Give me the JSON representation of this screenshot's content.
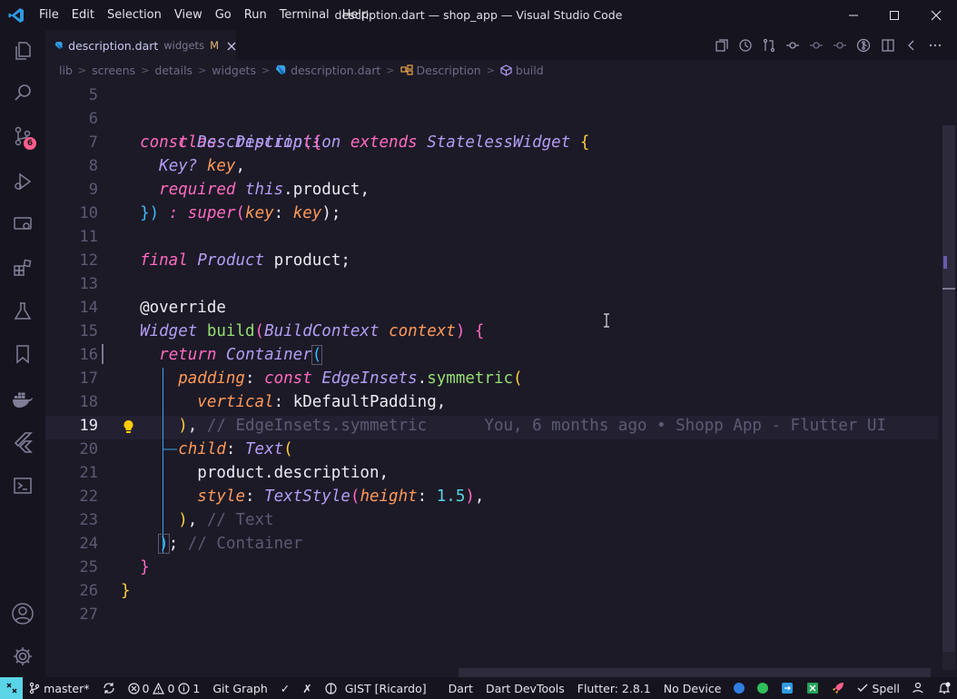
{
  "window": {
    "title": "description.dart — shop_app — Visual Studio Code"
  },
  "menu": [
    "File",
    "Edit",
    "Selection",
    "View",
    "Go",
    "Run",
    "Terminal",
    "Help"
  ],
  "activity_bar": {
    "icons": [
      "explorer-icon",
      "search-icon",
      "source-control-icon",
      "run-debug-icon",
      "remote-explorer-icon",
      "extensions-icon",
      "testing-icon",
      "bookmarks-icon",
      "docker-icon",
      "flutter-icon",
      "powershell-icon",
      "account-icon",
      "settings-gear-icon"
    ],
    "source_control_badge": "6"
  },
  "tab": {
    "filename": "description.dart",
    "description": "widgets",
    "modified": "M"
  },
  "breadcrumb": [
    "lib",
    "screens",
    "details",
    "widgets",
    "description.dart",
    "Description",
    "build"
  ],
  "editor": {
    "line_numbers": [
      "5",
      "6",
      "7",
      "8",
      "9",
      "10",
      "11",
      "12",
      "13",
      "14",
      "15",
      "16",
      "17",
      "18",
      "19",
      "20",
      "21",
      "22",
      "23",
      "24",
      "25",
      "26",
      "27"
    ],
    "active_line": "19",
    "code": {
      "l6": [
        "class",
        "Description",
        "extends",
        "StatelessWidget",
        "{"
      ],
      "l7": [
        "const",
        "Description",
        "({"
      ],
      "l8": [
        "Key?",
        "key",
        ","
      ],
      "l9": [
        "required",
        "this",
        ".product,"
      ],
      "l10": [
        "})",
        ":",
        "super",
        "(",
        "key",
        ":",
        "key",
        ");"
      ],
      "l12": [
        "final",
        "Product",
        "product;"
      ],
      "l14": [
        "@override"
      ],
      "l15": [
        "Widget",
        "build",
        "(",
        "BuildContext",
        "context",
        ")",
        "{"
      ],
      "l16": [
        "return",
        "Container",
        "("
      ],
      "l17": [
        "padding",
        ":",
        "const",
        "EdgeInsets",
        ".",
        "symmetric",
        "("
      ],
      "l18": [
        "vertical",
        ":",
        "kDefaultPadding",
        ","
      ],
      "l19": [
        ")",
        ",",
        "// EdgeInsets.symmetric"
      ],
      "l20": [
        "child",
        ":",
        "Text",
        "("
      ],
      "l21": [
        "product.description,"
      ],
      "l22": [
        "style",
        ":",
        "TextStyle",
        "(",
        "height",
        ":",
        "1.5",
        ")",
        ","
      ],
      "l23": [
        ")",
        ",",
        "// Text"
      ],
      "l24": [
        ")",
        ";",
        "// Container"
      ],
      "l25": [
        "}"
      ],
      "l26": [
        "}"
      ]
    },
    "blame": "You, 6 months ago • Shopp App - Flutter UI"
  },
  "status_bar": {
    "branch": "master*",
    "errors": "0",
    "warnings": "0",
    "info": "1",
    "git_graph": "Git Graph",
    "check": "✓",
    "cross": "✗",
    "gist": "GIST [Ricardo]",
    "language": "Dart",
    "devtools": "Dart DevTools",
    "flutter": "Flutter: 2.8.1",
    "device": "No Device",
    "spell": "Spell"
  },
  "colors": {
    "background": "#1c1a27",
    "chrome": "#16141f",
    "keyword": "#ff6ac1",
    "type": "#b39df3",
    "parameter": "#ff9959",
    "function": "#95e072",
    "number": "#5ad4e6",
    "comment": "#5c5b73",
    "accent": "#5ad4e6"
  }
}
